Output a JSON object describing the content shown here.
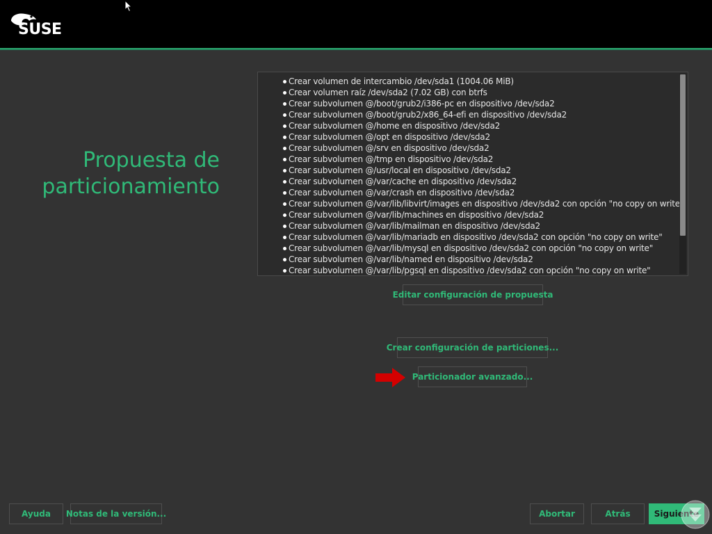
{
  "header": {
    "logo_text": "SUSE",
    "accent_color": "#30ba78"
  },
  "title": {
    "line1": "Propuesta de",
    "line2": "particionamiento"
  },
  "proposal": {
    "items": [
      "Crear volumen de intercambio /dev/sda1 (1004.06 MiB)",
      "Crear volumen raíz /dev/sda2 (7.02 GB) con btrfs",
      "Crear subvolumen @/boot/grub2/i386-pc en dispositivo /dev/sda2",
      "Crear subvolumen @/boot/grub2/x86_64-efi en dispositivo /dev/sda2",
      "Crear subvolumen @/home en dispositivo /dev/sda2",
      "Crear subvolumen @/opt en dispositivo /dev/sda2",
      "Crear subvolumen @/srv en dispositivo /dev/sda2",
      "Crear subvolumen @/tmp en dispositivo /dev/sda2",
      "Crear subvolumen @/usr/local en dispositivo /dev/sda2",
      "Crear subvolumen @/var/cache en dispositivo /dev/sda2",
      "Crear subvolumen @/var/crash en dispositivo /dev/sda2",
      "Crear subvolumen @/var/lib/libvirt/images en dispositivo /dev/sda2 con opción \"no copy on write\"",
      "Crear subvolumen @/var/lib/machines en dispositivo /dev/sda2",
      "Crear subvolumen @/var/lib/mailman en dispositivo /dev/sda2",
      "Crear subvolumen @/var/lib/mariadb en dispositivo /dev/sda2 con opción \"no copy on write\"",
      "Crear subvolumen @/var/lib/mysql en dispositivo /dev/sda2 con opción \"no copy on write\"",
      "Crear subvolumen @/var/lib/named en dispositivo /dev/sda2",
      "Crear subvolumen @/var/lib/pgsql en dispositivo /dev/sda2 con opción \"no copy on write\""
    ]
  },
  "actions": {
    "edit_label": "Editar configuración de propuesta",
    "create_label": "Crear configuración de particiones...",
    "advanced_label": "Particionador avanzado..."
  },
  "footer": {
    "help_label": "Ayuda",
    "release_notes_label": "Notas de la versión...",
    "abort_label": "Abortar",
    "back_label": "Atrás",
    "next_label": "Siguiente"
  }
}
